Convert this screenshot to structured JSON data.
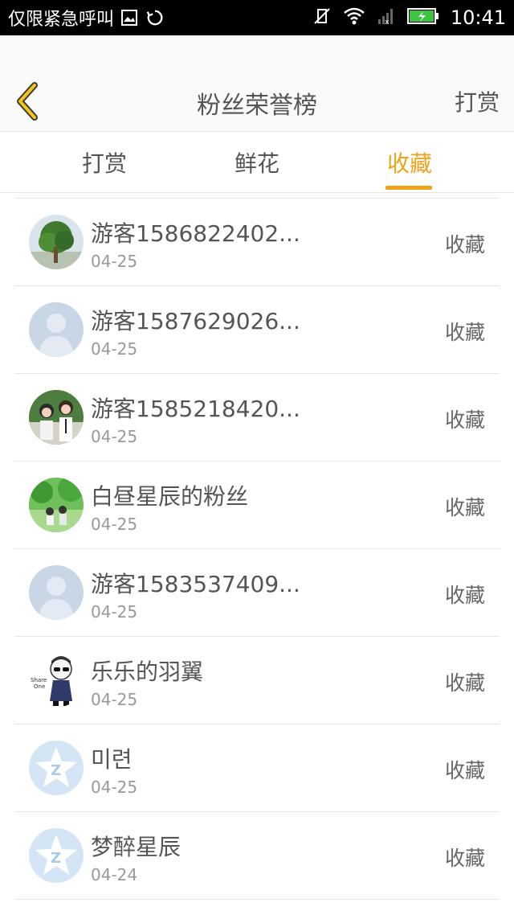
{
  "status_bar": {
    "carrier": "仅限紧急呼叫",
    "time": "10:41",
    "icons": [
      "picture-icon",
      "sync-icon",
      "vibrate-off-icon",
      "wifi-icon",
      "signal-icon",
      "battery-icon"
    ]
  },
  "header": {
    "title": "粉丝荣誉榜",
    "right_action": "打赏",
    "back_icon": "chevron-left-icon"
  },
  "tabs": [
    {
      "label": "打赏",
      "active": false
    },
    {
      "label": "鲜花",
      "active": false
    },
    {
      "label": "收藏",
      "active": true
    }
  ],
  "colors": {
    "accent": "#f2a21a",
    "text": "#555555",
    "subtext": "#999999",
    "divider": "#e6e6e6"
  },
  "fans": [
    {
      "name": "游客1586822402...",
      "date": "04-25",
      "action": "收藏",
      "avatar": "tree-photo-avatar"
    },
    {
      "name": "游客1587629026...",
      "date": "04-25",
      "action": "收藏",
      "avatar": "default-user-avatar"
    },
    {
      "name": "游客1585218420...",
      "date": "04-25",
      "action": "收藏",
      "avatar": "couple-photo-avatar"
    },
    {
      "name": "白昼星辰的粉丝",
      "date": "04-25",
      "action": "收藏",
      "avatar": "green-scene-avatar"
    },
    {
      "name": "游客1583537409...",
      "date": "04-25",
      "action": "收藏",
      "avatar": "default-user-avatar"
    },
    {
      "name": "乐乐的羽翼",
      "date": "04-25",
      "action": "收藏",
      "avatar": "cartoon-boy-avatar"
    },
    {
      "name": "미련",
      "date": "04-25",
      "action": "收藏",
      "avatar": "qq-star-avatar"
    },
    {
      "name": "梦醉星辰",
      "date": "04-24",
      "action": "收藏",
      "avatar": "qq-star-avatar"
    }
  ]
}
